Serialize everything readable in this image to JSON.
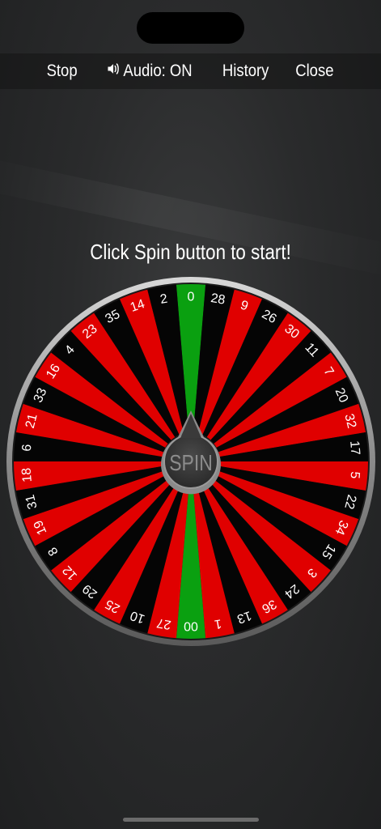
{
  "toolbar": {
    "stop_label": "Stop",
    "audio_label": "Audio: ON",
    "history_label": "History",
    "close_label": "Close",
    "audio_icon": "speaker-icon"
  },
  "message": "Click Spin button to start!",
  "wheel": {
    "spin_label": "SPIN",
    "pockets": [
      "0",
      "28",
      "9",
      "26",
      "30",
      "11",
      "7",
      "20",
      "32",
      "17",
      "5",
      "22",
      "34",
      "15",
      "3",
      "24",
      "36",
      "13",
      "1",
      "00",
      "27",
      "10",
      "25",
      "29",
      "12",
      "8",
      "19",
      "31",
      "18",
      "6",
      "21",
      "33",
      "16",
      "4",
      "23",
      "35",
      "14",
      "2"
    ],
    "colors": [
      "green",
      "black",
      "red",
      "black",
      "red",
      "black",
      "red",
      "black",
      "red",
      "black",
      "red",
      "black",
      "red",
      "black",
      "red",
      "black",
      "red",
      "black",
      "red",
      "green",
      "red",
      "black",
      "red",
      "black",
      "red",
      "black",
      "red",
      "black",
      "red",
      "black",
      "red",
      "black",
      "red",
      "black",
      "red",
      "black",
      "red",
      "black"
    ],
    "palette": {
      "red": "#e00000",
      "black": "#050505",
      "green": "#0aa010"
    }
  }
}
